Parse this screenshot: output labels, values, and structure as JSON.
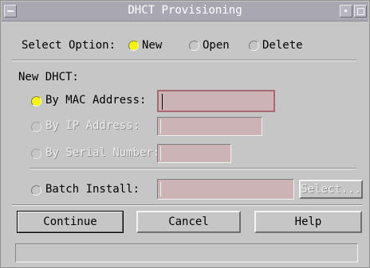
{
  "window": {
    "title": "DHCT Provisioning"
  },
  "select_option": {
    "label": "Select Option:",
    "options": [
      {
        "label": "New",
        "selected": true
      },
      {
        "label": "Open",
        "selected": false
      },
      {
        "label": "Delete",
        "selected": false
      }
    ]
  },
  "new_dhct": {
    "heading": "New DHCT:",
    "mac": {
      "label": "By MAC Address:",
      "value": ":  :  :  :  :",
      "selected": true,
      "enabled": true
    },
    "ip": {
      "label": "By IP Address:",
      "value": ".  .  .",
      "selected": false,
      "enabled": false
    },
    "serial": {
      "label": "By Serial Number:",
      "value": "",
      "selected": false,
      "enabled": false
    }
  },
  "batch": {
    "label": "Batch Install:",
    "value": "",
    "select_button": "Select..."
  },
  "buttons": {
    "continue": "Continue",
    "cancel": "Cancel",
    "help": "Help"
  },
  "status": {
    "text": ""
  },
  "colors": {
    "title_bar": "#a9a8b2",
    "window_bg": "#c6c6c6",
    "field_bg": "#ccb3b6",
    "radio_selected": "#f7f400"
  }
}
